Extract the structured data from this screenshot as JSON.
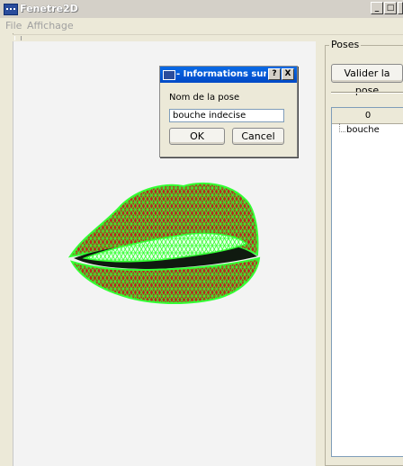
{
  "window": {
    "title": "Fenetre2D"
  },
  "menu": {
    "items": [
      "File",
      "Affichage"
    ]
  },
  "poses_panel": {
    "legend": "Poses",
    "validate_button": "Valider la pose",
    "tree_header": "0",
    "tree_items": [
      "bouche"
    ]
  },
  "dialog": {
    "title": "- Informations sur l...",
    "help_button": "?",
    "close_button": "X",
    "label": "Nom de la pose",
    "input_value": "bouche indecise",
    "ok_label": "OK",
    "cancel_label": "Cancel"
  },
  "colors": {
    "mesh_lines": "#33ff33",
    "lip_fill": "#b8281e",
    "teeth_fill": "#e8ffe8",
    "mouth_gap": "#101a10"
  }
}
